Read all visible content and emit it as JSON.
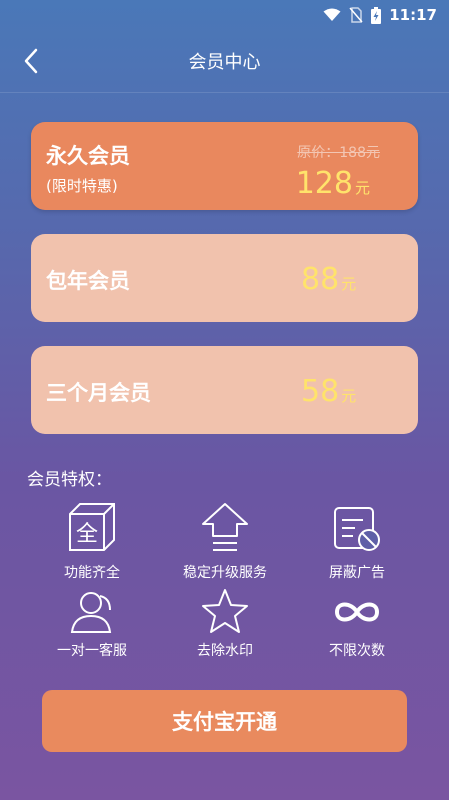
{
  "status_bar": {
    "time": "11:17"
  },
  "header": {
    "title": "会员中心"
  },
  "plans": [
    {
      "name": "永久会员",
      "sub": "(限时特惠)",
      "original_price": "原价：188元",
      "price": "128",
      "unit": "元"
    },
    {
      "name": "包年会员",
      "price": "88",
      "unit": "元"
    },
    {
      "name": "三个月会员",
      "price": "58",
      "unit": "元"
    }
  ],
  "perks": {
    "title": "会员特权：",
    "items": [
      {
        "label": "功能齐全",
        "icon": "box-all-icon",
        "icon_text": "全"
      },
      {
        "label": "稳定升级服务",
        "icon": "upgrade-arrow-icon"
      },
      {
        "label": "屏蔽广告",
        "icon": "block-ad-icon"
      },
      {
        "label": "一对一客服",
        "icon": "customer-service-icon"
      },
      {
        "label": "去除水印",
        "icon": "star-icon"
      },
      {
        "label": "不限次数",
        "icon": "infinity-icon"
      }
    ]
  },
  "pay_button": {
    "label": "支付宝开通"
  },
  "colors": {
    "primary_card": "#e9885e",
    "secondary_card": "#f1c2ad",
    "price": "#ffe36b",
    "button": "#e98a5e"
  }
}
